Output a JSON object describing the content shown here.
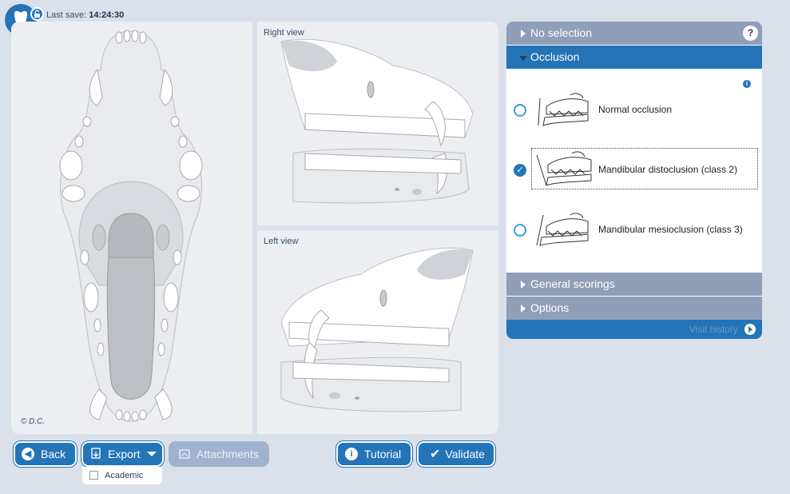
{
  "header": {
    "last_save_label": "Last save:",
    "last_save_time": "14:24:30"
  },
  "views": {
    "right_view_label": "Right view",
    "left_view_label": "Left view",
    "copyright": "© D.C."
  },
  "accordion": {
    "no_selection": "No selection",
    "help_label": "?",
    "occlusion": "Occlusion",
    "info_label": "i",
    "options": [
      {
        "label": "Normal occlusion",
        "selected": false
      },
      {
        "label": "Mandibular distoclusion (class 2)",
        "selected": true
      },
      {
        "label": "Mandibular mesioclusion (class 3)",
        "selected": false
      }
    ],
    "general_scorings": "General scorings",
    "options_section": "Options",
    "visit_history": "Visit history"
  },
  "toolbar": {
    "back": "Back",
    "export": "Export",
    "academic": "Academic",
    "attachments": "Attachments",
    "tutorial": "Tutorial",
    "validate": "Validate"
  },
  "colors": {
    "accent": "#2474b8",
    "collapsed_header": "#8f9fb8",
    "background": "#dbe1ea",
    "panel": "#eceef2"
  }
}
